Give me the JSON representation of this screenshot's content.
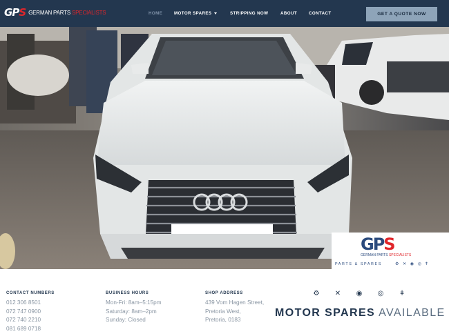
{
  "header": {
    "logo": {
      "mark_g": "G",
      "mark_p": "P",
      "mark_s": "S",
      "text_main": "GERMAN PARTS ",
      "text_accent": "SPECIALISTS"
    },
    "nav": [
      {
        "label": "HOME",
        "active": true
      },
      {
        "label": "MOTOR SPARES",
        "has_dropdown": true
      },
      {
        "label": "STRIPPING NOW"
      },
      {
        "label": "ABOUT"
      },
      {
        "label": "CONTACT"
      }
    ],
    "cta_label": "GET A QUOTE NOW"
  },
  "hero": {
    "badge": {
      "mark_g": "G",
      "mark_p": "P",
      "mark_s": "S",
      "text_main": "GERMAN PARTS ",
      "text_accent": "SPECIALISTS",
      "tagline": "PARTS & SPARES",
      "icons": [
        "engine-icon",
        "tools-icon",
        "turbo-icon",
        "brake-disc-icon",
        "spark-plug-icon"
      ]
    }
  },
  "footer": {
    "contact": {
      "title": "CONTACT NUMBERS",
      "lines": [
        "012 306 8501",
        "072 747 0900",
        "072 740 2210",
        "081 689 0718"
      ]
    },
    "hours": {
      "title": "BUSINESS HOURS",
      "lines": [
        "Mon-Fri: 8am–5:15pm",
        "Saturday: 8am–2pm",
        "Sunday: Closed"
      ]
    },
    "address": {
      "title": "SHOP ADDRESS",
      "lines": [
        "439 Vom Hagen Street,",
        "Pretoria West,",
        "Pretoria, 0183"
      ]
    },
    "motor_spares": {
      "icons": [
        "engine-icon",
        "tools-icon",
        "turbo-icon",
        "brake-disc-icon",
        "spark-plug-icon"
      ],
      "bold": "MOTOR SPARES",
      "light": "AVAILABLE"
    }
  },
  "colors": {
    "header_bg": "#23374f",
    "cta_bg": "#8ea4b9",
    "accent_red": "#e0262b",
    "footer_text": "#8a96a3"
  }
}
